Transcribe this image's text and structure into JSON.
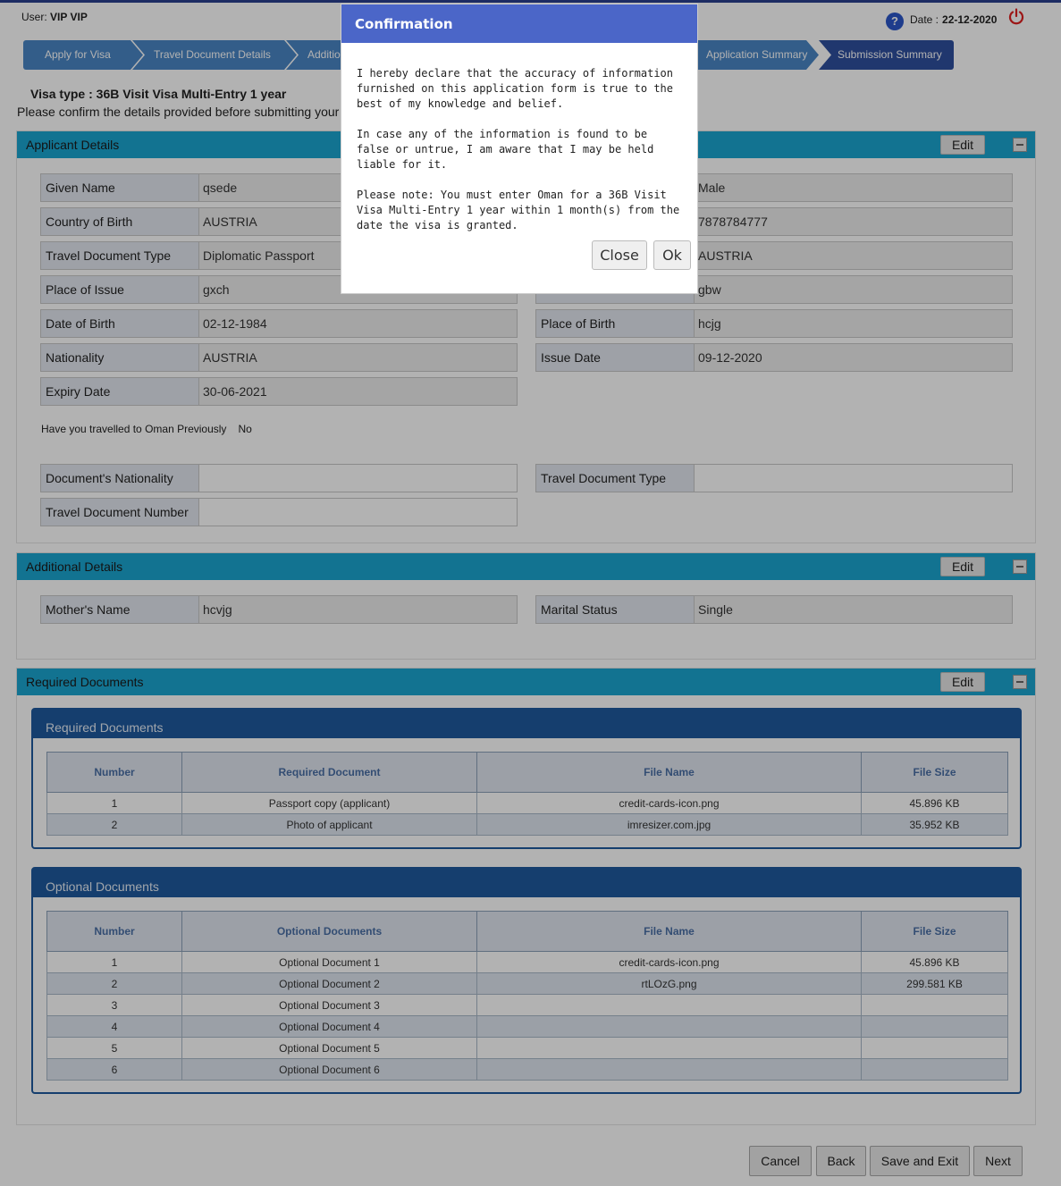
{
  "header": {
    "user_label": "User:",
    "user_name": "VIP  VIP",
    "date_label": "Date :",
    "date_value": "22-12-2020"
  },
  "steps": [
    "Apply for Visa",
    "Travel Document Details",
    "Additional",
    "Application Summary",
    "Submission Summary"
  ],
  "visa_type_label": "Visa type",
  "visa_type_value": ":  36B Visit Visa Multi-Entry 1 year",
  "confirm_prompt": "Please confirm the details provided before submitting your",
  "applicant_panel": {
    "title": "Applicant Details",
    "edit_label": "Edit",
    "fields": [
      {
        "label": "Given Name",
        "value": "qsede"
      },
      {
        "label": "",
        "value": "Male"
      },
      {
        "label": "Country of Birth",
        "value": "AUSTRIA"
      },
      {
        "label": "",
        "value": "7878784777"
      },
      {
        "label": "Travel Document Type",
        "value": "Diplomatic Passport"
      },
      {
        "label": "",
        "value": "AUSTRIA"
      },
      {
        "label": "Place of Issue",
        "value": "gxch"
      },
      {
        "label": "",
        "value": "gbw"
      },
      {
        "label": "Date of Birth",
        "value": "02-12-1984"
      },
      {
        "label": "Place of Birth",
        "value": "hcjg"
      },
      {
        "label": "Nationality",
        "value": "AUSTRIA"
      },
      {
        "label": "Issue Date",
        "value": "09-12-2020"
      },
      {
        "label": "Expiry Date",
        "value": "30-06-2021"
      }
    ],
    "travelled_label": "Have you travelled to Oman Previously",
    "travelled_value": "No",
    "extra_fields": [
      {
        "label": "Document's Nationality",
        "value": ""
      },
      {
        "label": "Travel Document Type",
        "value": ""
      },
      {
        "label": "Travel Document Number",
        "value": ""
      }
    ]
  },
  "additional_panel": {
    "title": "Additional Details",
    "edit_label": "Edit",
    "fields": [
      {
        "label": "Mother's Name",
        "value": "hcvjg"
      },
      {
        "label": "Marital Status",
        "value": "Single"
      }
    ]
  },
  "documents_panel": {
    "title": "Required Documents",
    "edit_label": "Edit",
    "required": {
      "title": "Required Documents",
      "headers": [
        "Number",
        "Required Document",
        "File Name",
        "File Size"
      ],
      "rows": [
        [
          "1",
          "Passport copy (applicant)",
          "credit-cards-icon.png",
          "45.896 KB"
        ],
        [
          "2",
          "Photo of applicant",
          "imresizer.com.jpg",
          "35.952 KB"
        ]
      ]
    },
    "optional": {
      "title": "Optional Documents",
      "headers": [
        "Number",
        "Optional Documents",
        "File Name",
        "File Size"
      ],
      "rows": [
        [
          "1",
          "Optional Document 1",
          "credit-cards-icon.png",
          "45.896 KB"
        ],
        [
          "2",
          "Optional Document 2",
          "rtLOzG.png",
          "299.581 KB"
        ],
        [
          "3",
          "Optional Document 3",
          "",
          ""
        ],
        [
          "4",
          "Optional Document 4",
          "",
          ""
        ],
        [
          "5",
          "Optional Document 5",
          "",
          ""
        ],
        [
          "6",
          "Optional Document 6",
          "",
          ""
        ]
      ]
    }
  },
  "bottom_buttons": {
    "cancel": "Cancel",
    "back": "Back",
    "save_exit": "Save and Exit",
    "next": "Next"
  },
  "modal": {
    "title": "Confirmation",
    "paragraphs": [
      "I hereby declare that the accuracy of information furnished on this application form is true to the best of my knowledge and belief.",
      "In case any of the information is found to be false or untrue, I am aware that I may be held liable for it.",
      "Please note: You must enter Oman for a 36B Visit Visa Multi-Entry 1 year within 1 month(s) from the date the visa is granted."
    ],
    "close_label": "Close",
    "ok_label": "Ok"
  }
}
